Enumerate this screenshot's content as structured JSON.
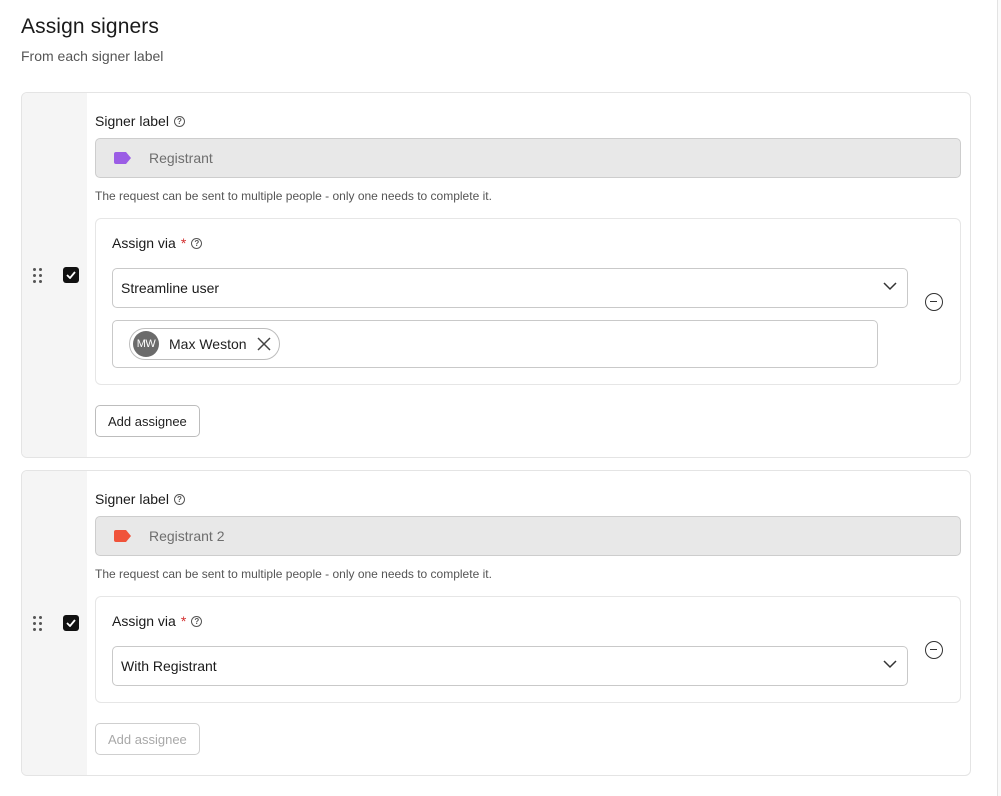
{
  "header": {
    "title": "Assign signers",
    "subtitle": "From each signer label"
  },
  "signers": [
    {
      "label_title": "Signer label",
      "label_value": "Registrant",
      "tag_color": "#9b5de5",
      "hint": "The request can be sent to multiple people - only one needs to complete it.",
      "checked": true,
      "assign_via_label": "Assign via",
      "required_mark": "*",
      "assign_via_value": "Streamline user",
      "assignees": [
        {
          "initials": "MW",
          "name": "Max Weston"
        }
      ],
      "add_assignee_label": "Add assignee",
      "add_assignee_enabled": true
    },
    {
      "label_title": "Signer label",
      "label_value": "Registrant 2",
      "tag_color": "#f0533a",
      "hint": "The request can be sent to multiple people - only one needs to complete it.",
      "checked": true,
      "assign_via_label": "Assign via",
      "required_mark": "*",
      "assign_via_value": "With Registrant",
      "assignees": [],
      "add_assignee_label": "Add assignee",
      "add_assignee_enabled": false
    }
  ],
  "icons": {
    "help": "question-circle-icon",
    "drag": "drag-handle-icon",
    "remove": "minus-circle-icon",
    "chevron": "chevron-down-icon",
    "close": "close-icon",
    "tag": "tag-icon"
  }
}
